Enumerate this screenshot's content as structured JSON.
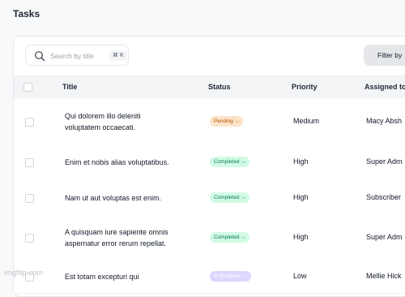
{
  "page": {
    "title": "Tasks"
  },
  "search": {
    "placeholder": "Search by title",
    "shortcut": "⌘ K"
  },
  "toolbar": {
    "filter_label": "Filter by"
  },
  "table": {
    "headers": {
      "title": "Title",
      "status": "Status",
      "priority": "Priority",
      "assigned": "Assigned to"
    },
    "rows": [
      {
        "title_line1": "Qui dolorem illo deleniti",
        "title_line2": "voluptatem occaecati.",
        "status": "Pending",
        "priority": "Medium",
        "assigned": "Macy Absh"
      },
      {
        "title_line1": "Enim et nobis alias voluptatibus.",
        "title_line2": "",
        "status": "Completed",
        "priority": "High",
        "assigned": "Super Adm"
      },
      {
        "title_line1": "Nam ut aut voluptas est enim.",
        "title_line2": "",
        "status": "Completed",
        "priority": "High",
        "assigned": "Subscriber"
      },
      {
        "title_line1": "A quisquam iure sapiente omnis",
        "title_line2": "aspernatur error rerum repellat.",
        "status": "Completed",
        "priority": "High",
        "assigned": "Super Adm"
      },
      {
        "title_line1": "Est totam excepturi qui",
        "title_line2": "",
        "status": "In Progress",
        "priority": "Low",
        "assigned": "Mellie Hick"
      }
    ]
  },
  "status_colors": {
    "Pending": {
      "bg": "#fde4c8",
      "fg": "#b45309"
    },
    "Completed": {
      "bg": "#d1fae5",
      "fg": "#047857"
    },
    "In Progress": {
      "bg": "#ddd6fe",
      "fg": "#ffffff"
    }
  },
  "watermark": "imgflip.com"
}
